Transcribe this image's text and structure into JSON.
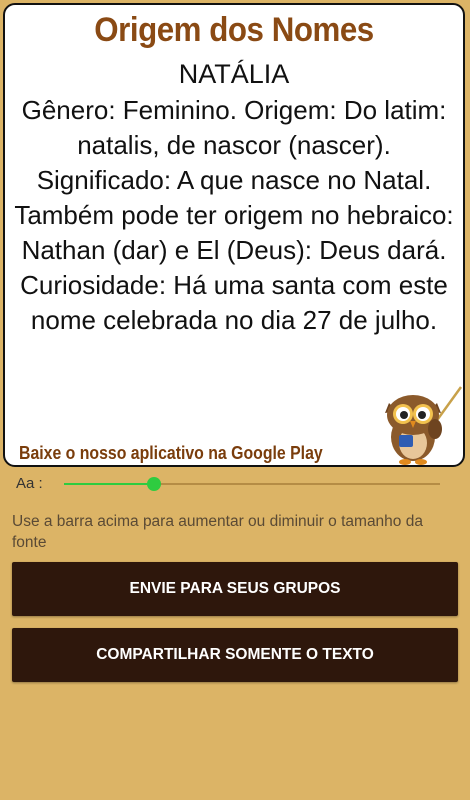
{
  "card": {
    "title": "Origem dos Nomes",
    "name": "NATÁLIA",
    "description": "Gênero: Feminino. Origem: Do latim: natalis, de nascor (nascer). Significado: A que nasce no Natal. Também pode ter origem no hebraico: Nathan (dar) e El (Deus): Deus dará. Curiosidade: Há uma santa com este nome celebrada no dia 27 de julho.",
    "promo": "Baixe o nosso aplicativo na Google Play",
    "mascot_icon": "owl-teacher-icon"
  },
  "font_control": {
    "label": "Aa :",
    "slider_value": 0.24,
    "hint": "Use a barra acima para aumentar ou diminuir o tamanho da fonte"
  },
  "buttons": {
    "send_groups": "ENVIE PARA SEUS GRUPOS",
    "share_text": "COMPARTILHAR SOMENTE O TEXTO"
  },
  "colors": {
    "background": "#dcb466",
    "title": "#8a4a14",
    "button": "#2e170c",
    "slider": "#2ecc40"
  }
}
